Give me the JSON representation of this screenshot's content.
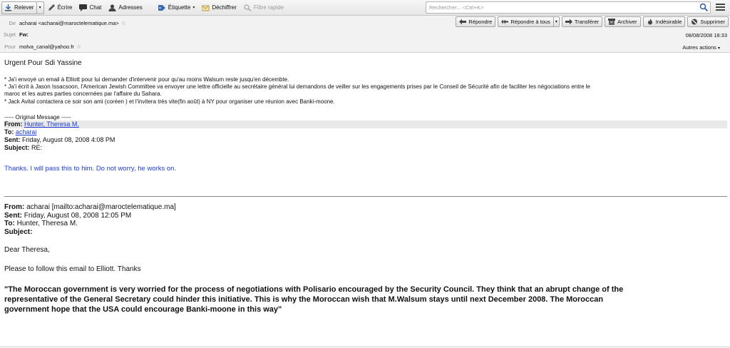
{
  "toolbar": {
    "get_messages": "Relever",
    "write": "Écrire",
    "chat": "Chat",
    "address_book": "Adresses",
    "tag": "Étiquette",
    "decrypt": "Déchiffrer",
    "quick_filter": "Filtre rapide",
    "search_placeholder": "Rechercher... <Ctrl+K>"
  },
  "header": {
    "from_label": "De",
    "from_value": "acharai <acharai@maroctelematique.ma>",
    "subject_label": "Sujet",
    "subject_value": "Fw:",
    "to_label": "Pour",
    "to_value": "molva_canal@yahoo.fr",
    "date": "08/08/2008 18:33",
    "other_actions": "Autres actions",
    "buttons": {
      "reply": "Répondre",
      "reply_all": "Répondre à tous",
      "forward": "Transférer",
      "archive": "Archiver",
      "junk": "Indésirable",
      "delete": "Supprimer"
    }
  },
  "message": {
    "title": "Urgent Pour Sdi Yassine",
    "bullets": [
      "* Ja'i envoyé un email à Elliott pour lui demander d'intervenir pour qu'au moins Walsum reste jusqu'en décembte.",
      "* Ja'i écrit à Jason Issacsoon, l'American Jewish Committee va envoyer une lettre officielle au secrétaire général lui demandons de veiller sur les engagements prises par le Conseil de Sécurité afin de faciliter les négociations entre le",
      "maroc et les autres parties concernées par l'affaire du Sahara.",
      "* Jack Avital contactera ce soir son ami (coréen ) et l'invitera très vite(fin août)  à NY pour organiser une réunion avec Banki-moone."
    ],
    "original_marker": "----- Original Message -----",
    "quoted": {
      "from_label": "From:",
      "from_value": "Hunter, Theresa M.",
      "to_label": "To:",
      "to_value": "acharai",
      "sent_label": "Sent:",
      "sent_value": "Friday, August 08, 2008 4:08 PM",
      "subject_label": "Subject:",
      "subject_value": "RE:",
      "reply_text": "Thanks. I will pass this to him. Do not worry, he works on."
    },
    "second": {
      "from_label": "From:",
      "from_value": "acharai [mailto:acharai@maroctelematique.ma]",
      "sent_label": "Sent:",
      "sent_value": "Friday, August 08, 2008 12:05 PM",
      "to_label": "To:",
      "to_value": "Hunter, Theresa M.",
      "subject_label": "Subject:",
      "subject_value": "",
      "greeting": "Dear Theresa,",
      "line": "Please to follow this email to Elliott. Thanks",
      "bold_lines": [
        "\"The Moroccan government is very worried  for the process of negotiations with Polisario encouraged by the Security Council. They think that an abrupt change of the",
        "representative of the General Secretary could hinder this initiative. This is why the Moroccan wish that M.Walsum stays until next December 2008. The Moroccan",
        "government hope that the USA could encourage Banki-moone in this way\""
      ]
    }
  }
}
